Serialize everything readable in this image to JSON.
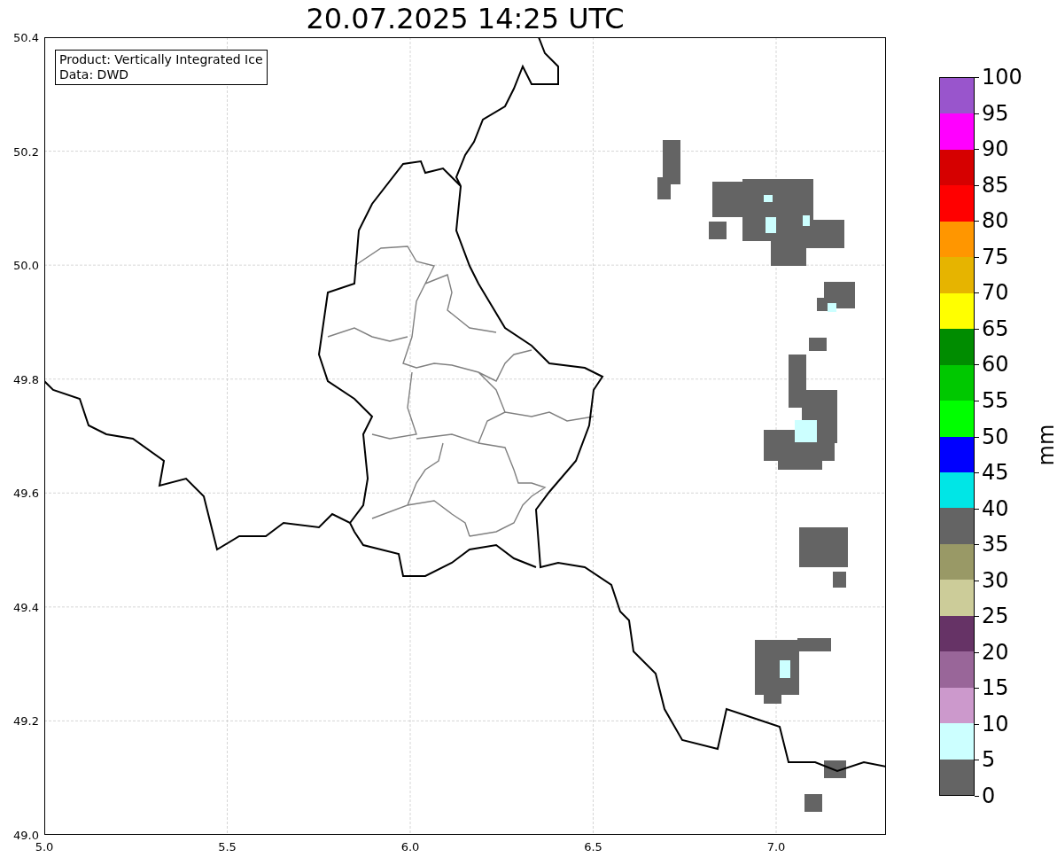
{
  "title": "20.07.2025 14:25 UTC",
  "info_box": {
    "lines": [
      "Product: Vertically Integrated Ice",
      "Data: DWD"
    ]
  },
  "x_ticks": [
    "5.0",
    "5.5",
    "6.0",
    "6.5",
    "7.0"
  ],
  "y_ticks": [
    "50.4",
    "50.2",
    "50.0",
    "49.8",
    "49.6",
    "49.4",
    "49.2",
    "49.0"
  ],
  "colorbar": {
    "label": "mm",
    "ticks": [
      "100",
      "95",
      "90",
      "85",
      "80",
      "75",
      "70",
      "65",
      "60",
      "55",
      "50",
      "45",
      "40",
      "35",
      "30",
      "25",
      "20",
      "15",
      "10",
      "5",
      "0"
    ],
    "segments": [
      {
        "color": "#9955cc"
      },
      {
        "color": "#ff00ff"
      },
      {
        "color": "#d60000"
      },
      {
        "color": "#ff0000"
      },
      {
        "color": "#ff9600"
      },
      {
        "color": "#e6b400"
      },
      {
        "color": "#ffff00"
      },
      {
        "color": "#008c00"
      },
      {
        "color": "#00c800"
      },
      {
        "color": "#00ff00"
      },
      {
        "color": "#0000ff"
      },
      {
        "color": "#00e6e6"
      },
      {
        "color": "#646464"
      },
      {
        "color": "#999966"
      },
      {
        "color": "#cccc99"
      },
      {
        "color": "#663366"
      },
      {
        "color": "#996699"
      },
      {
        "color": "#cc99cc"
      },
      {
        "color": "#ccffff"
      },
      {
        "color": "#646464"
      }
    ]
  }
}
